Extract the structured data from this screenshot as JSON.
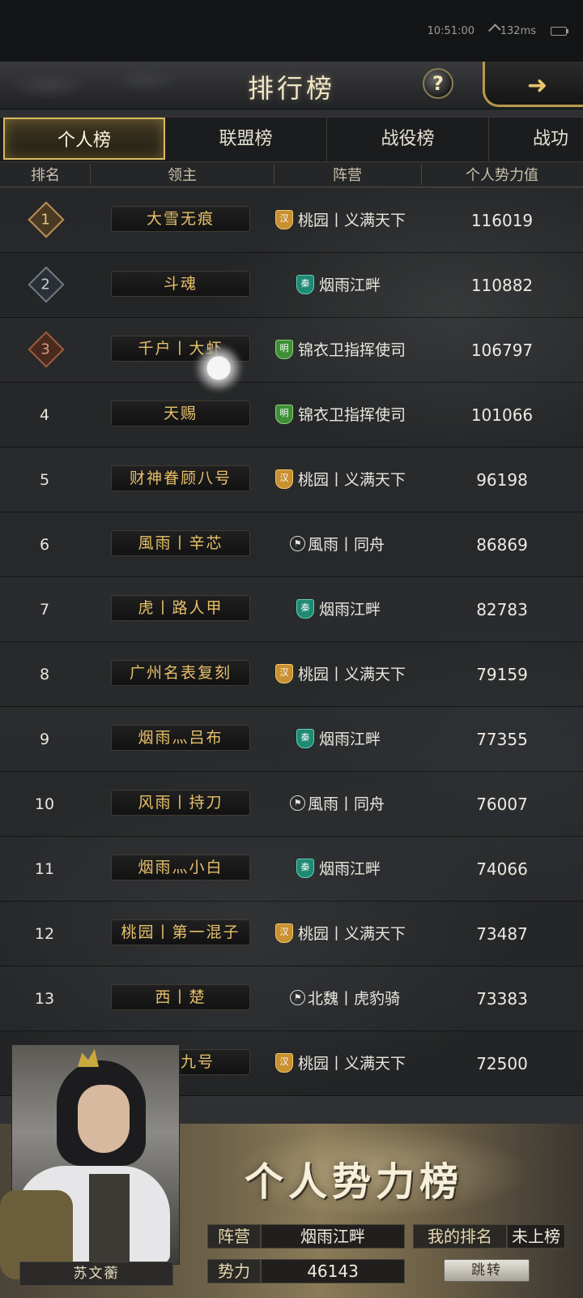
{
  "status": {
    "time": "10:51:00",
    "network": "132ms"
  },
  "header": {
    "title": "排行榜",
    "help_label": "?"
  },
  "tabs": [
    {
      "label": "个人榜",
      "active": true
    },
    {
      "label": "联盟榜",
      "active": false
    },
    {
      "label": "战役榜",
      "active": false
    },
    {
      "label": "战功",
      "active": false
    }
  ],
  "columns": {
    "rank": "排名",
    "lord": "领主",
    "camp": "阵营",
    "power": "个人势力值"
  },
  "rows": [
    {
      "rank": "1",
      "lord": "大雪无痕",
      "badge": "汉",
      "badge_type": "han",
      "camp": "桃园丨义满天下",
      "power": "116019"
    },
    {
      "rank": "2",
      "lord": "斗魂",
      "badge": "秦",
      "badge_type": "qin",
      "camp": "烟雨江畔",
      "power": "110882"
    },
    {
      "rank": "3",
      "lord": "千户丨大虾",
      "badge": "明",
      "badge_type": "ming",
      "camp": "锦衣卫指挥使司",
      "power": "106797"
    },
    {
      "rank": "4",
      "lord": "天赐",
      "badge": "明",
      "badge_type": "ming",
      "camp": "锦衣卫指挥使司",
      "power": "101066"
    },
    {
      "rank": "5",
      "lord": "财神眷顾八号",
      "badge": "汉",
      "badge_type": "han",
      "camp": "桃园丨义满天下",
      "power": "96198"
    },
    {
      "rank": "6",
      "lord": "風雨丨辛芯",
      "badge": "",
      "badge_type": "flag",
      "camp": "風雨丨同舟",
      "power": "86869"
    },
    {
      "rank": "7",
      "lord": "虎丨路人甲",
      "badge": "秦",
      "badge_type": "qin",
      "camp": "烟雨江畔",
      "power": "82783"
    },
    {
      "rank": "8",
      "lord": "广州名表复刻",
      "badge": "汉",
      "badge_type": "han",
      "camp": "桃园丨义满天下",
      "power": "79159"
    },
    {
      "rank": "9",
      "lord": "烟雨灬吕布",
      "badge": "秦",
      "badge_type": "qin",
      "camp": "烟雨江畔",
      "power": "77355"
    },
    {
      "rank": "10",
      "lord": "风雨丨持刀",
      "badge": "",
      "badge_type": "flag",
      "camp": "風雨丨同舟",
      "power": "76007"
    },
    {
      "rank": "11",
      "lord": "烟雨灬小白",
      "badge": "秦",
      "badge_type": "qin",
      "camp": "烟雨江畔",
      "power": "74066"
    },
    {
      "rank": "12",
      "lord": "桃园丨第一混子",
      "badge": "汉",
      "badge_type": "han",
      "camp": "桃园丨义满天下",
      "power": "73487"
    },
    {
      "rank": "13",
      "lord": "西丨楚",
      "badge": "",
      "badge_type": "flag",
      "camp": "北魏丨虎豹骑",
      "power": "73383"
    },
    {
      "rank": "",
      "lord": "眷顾九号",
      "badge": "汉",
      "badge_type": "han",
      "camp": "桃园丨义满天下",
      "power": "72500"
    }
  ],
  "panel": {
    "title": "个人势力榜",
    "hero_name": "苏文蘅",
    "camp_label": "阵营",
    "camp_value": "烟雨江畔",
    "my_rank_label": "我的排名",
    "my_rank_value": "未上榜",
    "power_label": "势力",
    "power_value": "46143",
    "jump_label": "跳转"
  }
}
